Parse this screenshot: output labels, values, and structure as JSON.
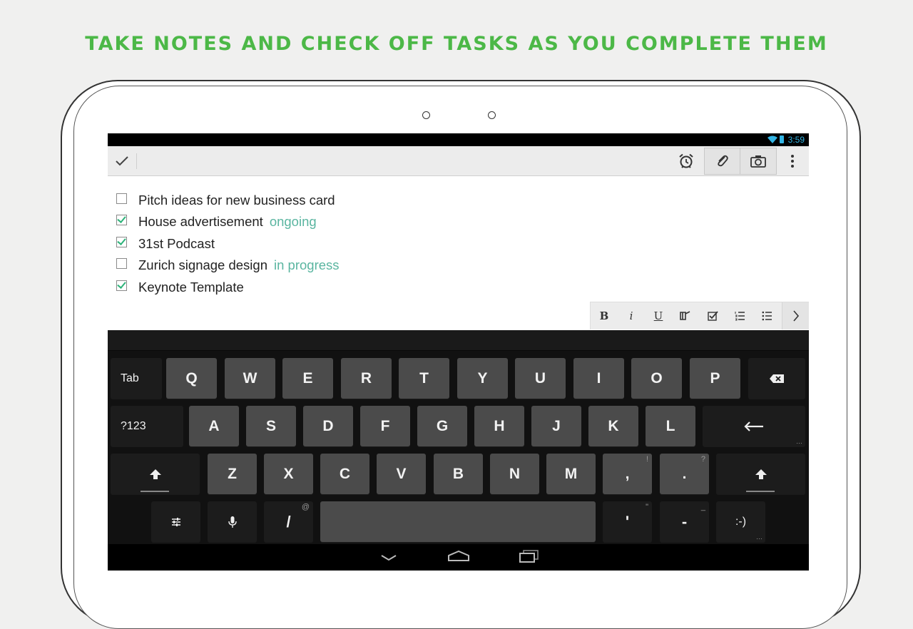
{
  "headline": "TAKE NOTES AND CHECK OFF TASKS AS YOU COMPLETE THEM",
  "status": {
    "time": "3:59"
  },
  "colors": {
    "accent": "#4cb847",
    "tag": "#5ab5a0",
    "status": "#33b5e5"
  },
  "toolbar": {
    "icons": [
      "check-icon",
      "alarm-icon",
      "paperclip-icon",
      "camera-icon",
      "overflow-icon"
    ]
  },
  "tasks": [
    {
      "text": "Pitch ideas for new business card",
      "checked": false,
      "tag": ""
    },
    {
      "text": "House advertisement",
      "checked": true,
      "tag": "ongoing"
    },
    {
      "text": "31st Podcast",
      "checked": true,
      "tag": ""
    },
    {
      "text": "Zurich signage design",
      "checked": false,
      "tag": "in progress"
    },
    {
      "text": "Keynote Template",
      "checked": true,
      "tag": ""
    }
  ],
  "format": {
    "bold": "B",
    "italic": "i",
    "underline": "U"
  },
  "keyboard": {
    "row1": [
      "Tab",
      "Q",
      "W",
      "E",
      "R",
      "T",
      "Y",
      "U",
      "I",
      "O",
      "P"
    ],
    "row2": [
      "?123",
      "A",
      "S",
      "D",
      "F",
      "G",
      "H",
      "J",
      "K",
      "L"
    ],
    "row3": [
      "Z",
      "X",
      "C",
      "V",
      "B",
      "N",
      "M",
      ",",
      "."
    ],
    "row3_hints": [
      "!",
      "?"
    ],
    "row4": {
      "slash": "/",
      "slash_hint": "@",
      "apostrophe": "'",
      "apostrophe_hint": "\"",
      "dash": "-",
      "dash_hint": "_",
      "smiley": ":-)"
    }
  }
}
